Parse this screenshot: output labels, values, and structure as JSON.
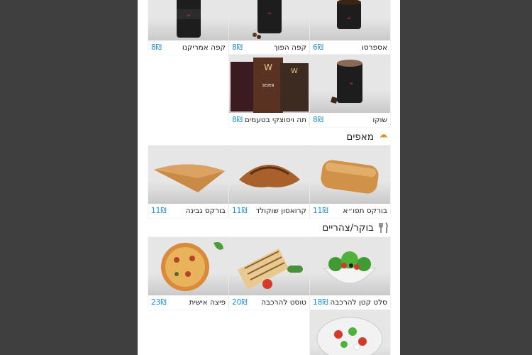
{
  "sections": {
    "pastries": {
      "title": "מאפים",
      "icon": "croissant-icon"
    },
    "breakfast": {
      "title": "בוקר/צהריים",
      "icon": "fork-knife-icon"
    }
  },
  "items": {
    "americano": {
      "name": "קפה אמריקנו",
      "price": "8₪"
    },
    "hafuch": {
      "name": "קפה הפוך",
      "price": "8₪"
    },
    "espresso": {
      "name": "אספרסו",
      "price": "6₪"
    },
    "tea": {
      "name": "תה ויסוצקי בטעמים",
      "price": "8₪"
    },
    "choco": {
      "name": "שוקו",
      "price": "8₪"
    },
    "burekas_cheese": {
      "name": "בורקס גבינה",
      "price": "11₪"
    },
    "croissant_choc": {
      "name": "קרואסון שוקולד",
      "price": "11₪"
    },
    "burekas_potato": {
      "name": "בורקס תפו״א",
      "price": "11₪"
    },
    "pizza": {
      "name": "פיצה אישית",
      "price": "23₪"
    },
    "toast": {
      "name": "טוסט להרכבה",
      "price": "20₪"
    },
    "salad_small": {
      "name": "סלט קטן להרכבה",
      "price": "18₪"
    }
  },
  "colors": {
    "price": "#1e8fd6",
    "page_bg": "#3f3f3f",
    "panel_bg": "#ffffff"
  }
}
